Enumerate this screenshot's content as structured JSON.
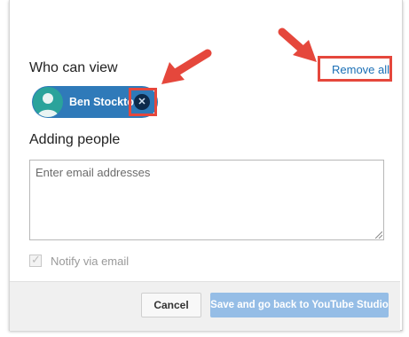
{
  "sharing": {
    "who_can_view_label": "Who can view",
    "remove_all_label": "Remove all",
    "viewer": {
      "name": "Ben Stockton",
      "remove_glyph": "✕"
    },
    "adding_people_label": "Adding people",
    "email_placeholder": "Enter email addresses",
    "notify": {
      "label": "Notify via email",
      "checked": true,
      "disabled": true
    }
  },
  "footer": {
    "cancel_label": "Cancel",
    "save_label": "Save and go back to YouTube Studio"
  },
  "colors": {
    "link": "#1a6fb6",
    "chip": "#2f7ab9",
    "avatar": "#2aa39b",
    "highlight": "#e5473c",
    "save_disabled": "#95bde6"
  }
}
